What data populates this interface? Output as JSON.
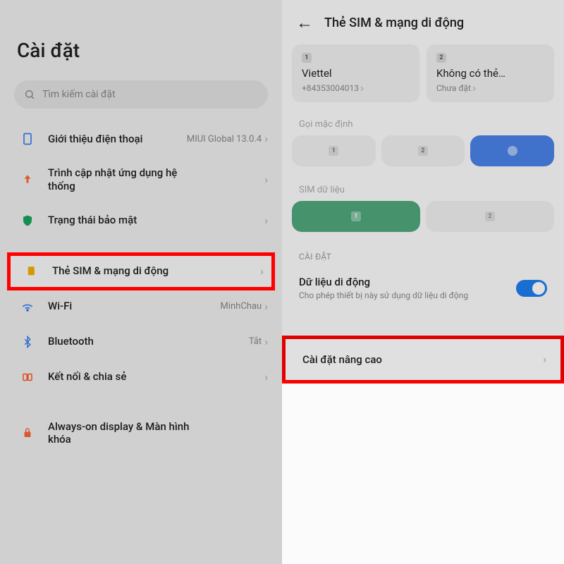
{
  "left": {
    "title": "Cài đặt",
    "search_placeholder": "Tìm kiếm cài đặt",
    "items": {
      "about": {
        "label": "Giới thiệu điện thoại",
        "value": "MIUI Global 13.0.4"
      },
      "updater": {
        "label": "Trình cập nhật ứng dụng hệ thống"
      },
      "security": {
        "label": "Trạng thái bảo mật"
      },
      "sim": {
        "label": "Thẻ SIM & mạng di động"
      },
      "wifi": {
        "label": "Wi-Fi",
        "value": "MinhChau"
      },
      "bluetooth": {
        "label": "Bluetooth",
        "value": "Tắt"
      },
      "connect": {
        "label": "Kết nối & chia sẻ"
      },
      "aod": {
        "label": "Always-on display & Màn hình khóa"
      }
    }
  },
  "right": {
    "title": "Thẻ SIM & mạng di động",
    "sim1": {
      "badge": "1",
      "name": "Viettel",
      "sub": "+84353004013"
    },
    "sim2": {
      "badge": "2",
      "name": "Không có thẻ…",
      "sub": "Chưa đặt"
    },
    "default_call": "Gọi mặc định",
    "data_sim_label": "SIM dữ liệu",
    "cat": "CÀI ĐẶT",
    "mobile_data": {
      "title": "Dữ liệu di động",
      "sub": "Cho phép thiết bị này sử dụng dữ liệu di động"
    },
    "advanced": "Cài đặt nâng cao"
  }
}
